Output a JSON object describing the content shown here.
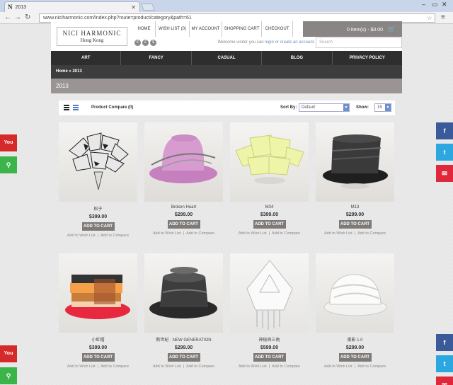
{
  "browser": {
    "tab_title": "2013",
    "url": "www.niciharmonic.com/index.php?route=product/category&path=61"
  },
  "header": {
    "logo_line1": "NICI HARMONIC",
    "logo_line2": "Hong Kong",
    "nav": [
      "HOME",
      "WISH LIST (0)",
      "MY ACCOUNT",
      "SHOPPING CART",
      "CHECKOUT"
    ],
    "cart_summary": "0 item(s) - $0.00",
    "welcome_prefix": "Welcome visitor you can ",
    "login": "login",
    "or": " or ",
    "create": "create an account",
    "welcome_suffix": ".",
    "search_placeholder": "Search",
    "flags": [
      "€",
      "£",
      "$"
    ]
  },
  "menu": [
    "ART",
    "FANCY",
    "CASUAL",
    "BLOG",
    "PRIVACY POLICY"
  ],
  "breadcrumb": "Home » 2013",
  "page_title": "2013",
  "toolbar": {
    "product_compare": "Product Compare (0)",
    "sort_label": "Sort By:",
    "sort_value": "Default",
    "show_label": "Show:",
    "show_value": "15"
  },
  "products": [
    {
      "name": "松子",
      "price": "$399.00"
    },
    {
      "name": "Broken Heart",
      "price": "$299.00"
    },
    {
      "name": "M34",
      "price": "$399.00"
    },
    {
      "name": "M13",
      "price": "$299.00"
    },
    {
      "name": "小紅帽",
      "price": "$399.00"
    },
    {
      "name": "新世紀 · NEW GENERATION",
      "price": "$299.00"
    },
    {
      "name": "神秘與三角",
      "price": "$599.00"
    },
    {
      "name": "蛋影 1.0",
      "price": "$299.00"
    }
  ],
  "product_labels": {
    "add_to_cart": "ADD TO CART",
    "wishlist": "Add to Wish List",
    "compare": "Add to Compare"
  },
  "social": {
    "youtube": "You",
    "map": "⚲",
    "facebook": "f",
    "twitter": "t",
    "chat": "✉"
  },
  "colors": {
    "menu_bg": "#2e2e2e",
    "title_bar": "#9b9494",
    "youtube": "#d62a2a",
    "map": "#3bb54a",
    "facebook": "#3b5a9a",
    "twitter": "#2ca7e0",
    "chat": "#e0283c"
  }
}
